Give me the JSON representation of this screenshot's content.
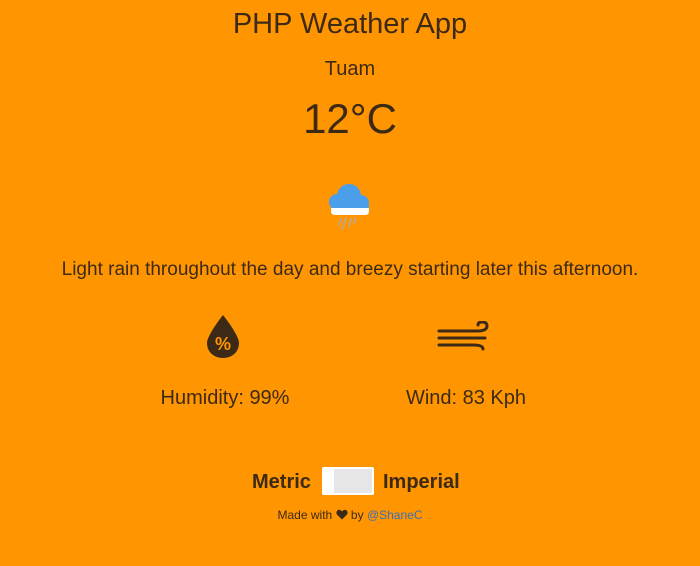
{
  "header": {
    "title": "PHP Weather App"
  },
  "location": {
    "city": "Tuam"
  },
  "current": {
    "temperature": "12°C",
    "icon": "rain-cloud-icon",
    "summary": "Light rain throughout the day and breezy starting later this afternoon."
  },
  "stats": {
    "humidity_icon": "humidity-drop-icon",
    "humidity": "Humidity: 99%",
    "wind_icon": "wind-icon",
    "wind": "Wind: 83 Kph"
  },
  "units": {
    "metric_label": "Metric",
    "imperial_label": "Imperial",
    "selected": "Metric"
  },
  "footer": {
    "made_with": "Made with",
    "heart_icon": "heart-icon",
    "by": "by",
    "author": "@ShaneC"
  },
  "colors": {
    "background": "#ff9500",
    "text": "#3d2a16",
    "link": "#3d6fb5",
    "cloud": "#4a9eea"
  }
}
